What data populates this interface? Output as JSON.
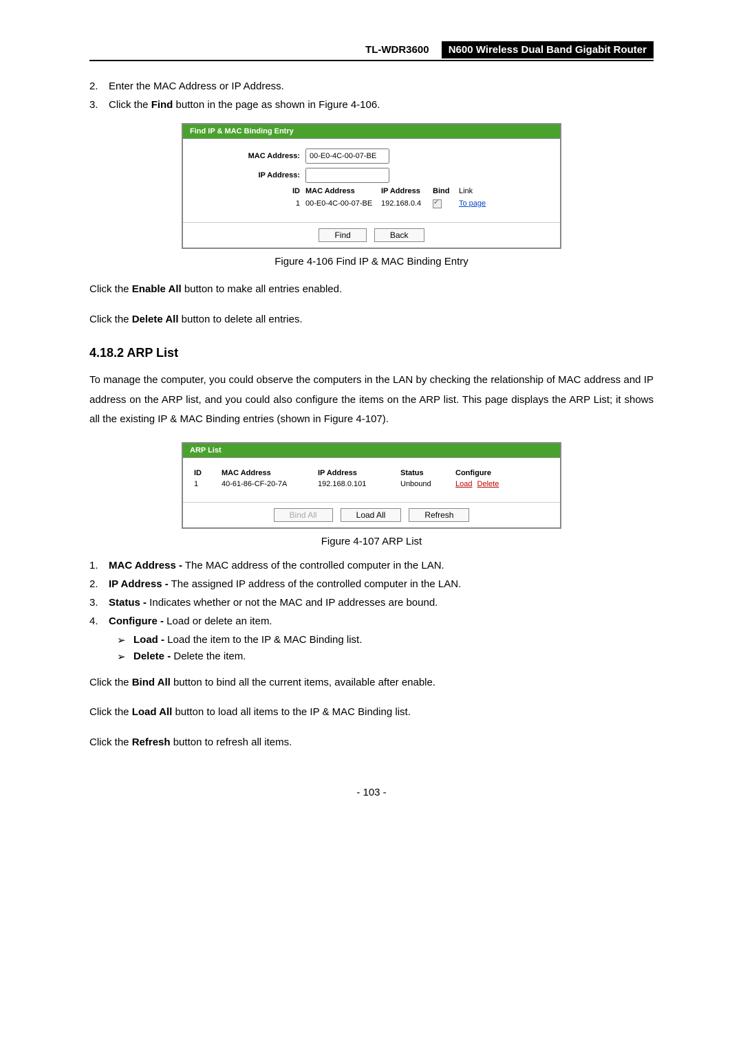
{
  "header": {
    "model": "TL-WDR3600",
    "product": "N600 Wireless Dual Band Gigabit Router"
  },
  "steps_top": [
    {
      "n": "2.",
      "text": "Enter the MAC Address or IP Address."
    },
    {
      "n": "3.",
      "pre": "Click the ",
      "bold": "Find",
      "post": " button in the page as shown in Figure 4-106."
    }
  ],
  "fig1": {
    "title": "Find IP & MAC Binding Entry",
    "mac_label": "MAC Address:",
    "mac_value": "00-E0-4C-00-07-BE",
    "ip_label": "IP Address:",
    "ip_value": "",
    "tbl": {
      "id_lbl": "ID",
      "h_mac": "MAC Address",
      "h_ip": "IP Address",
      "h_bind": "Bind",
      "h_link": "Link",
      "row_id": "1",
      "row_mac": "00-E0-4C-00-07-BE",
      "row_ip": "192.168.0.4",
      "row_link": "To page"
    },
    "btn_find": "Find",
    "btn_back": "Back",
    "caption": "Figure 4-106 Find IP & MAC Binding Entry"
  },
  "para1": {
    "pre": "Click the ",
    "bold": "Enable All",
    "post": " button to make all entries enabled."
  },
  "para2": {
    "pre": "Click the ",
    "bold": "Delete All",
    "post": " button to delete all entries."
  },
  "section_title": "4.18.2  ARP List",
  "section_intro": "To manage the computer, you could observe the computers in the LAN by checking the relationship of MAC address and IP address on the ARP list, and you could also configure the items on the ARP list. This page displays the ARP List; it shows all the existing IP & MAC Binding entries (shown in Figure 4-107).",
  "fig2": {
    "title": "ARP List",
    "h_id": "ID",
    "h_mac": "MAC Address",
    "h_ip": "IP Address",
    "h_status": "Status",
    "h_conf": "Configure",
    "row_id": "1",
    "row_mac": "40-61-86-CF-20-7A",
    "row_ip": "192.168.0.101",
    "row_status": "Unbound",
    "row_load": "Load",
    "row_delete": "Delete",
    "btn_bind": "Bind All",
    "btn_load": "Load All",
    "btn_refresh": "Refresh",
    "caption": "Figure 4-107 ARP List"
  },
  "defs": [
    {
      "n": "1.",
      "bold": "MAC Address -",
      "text": " The MAC address of the controlled computer in the LAN."
    },
    {
      "n": "2.",
      "bold": "IP Address -",
      "text": " The assigned IP address of the controlled computer in the LAN."
    },
    {
      "n": "3.",
      "bold": "Status -",
      "text": " Indicates whether or not the MAC and IP addresses are bound."
    },
    {
      "n": "4.",
      "bold": "Configure -",
      "text": " Load or delete an item."
    }
  ],
  "subdefs": [
    {
      "bold": "Load -",
      "text": " Load the item to the IP & MAC Binding list."
    },
    {
      "bold": "Delete -",
      "text": " Delete the item."
    }
  ],
  "para3": {
    "pre": "Click the ",
    "bold": "Bind All",
    "post": " button to bind all the current items, available after enable."
  },
  "para4": {
    "pre": "Click the ",
    "bold": "Load All",
    "post": " button to load all items to the IP & MAC Binding list."
  },
  "para5": {
    "pre": "Click the ",
    "bold": "Refresh",
    "post": " button to refresh all items."
  },
  "page_number": "- 103 -"
}
